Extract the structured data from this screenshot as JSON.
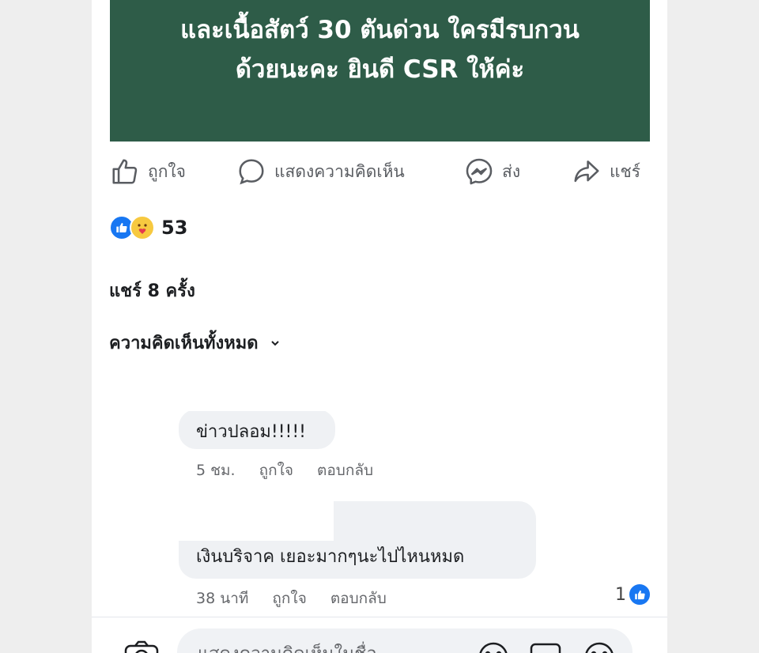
{
  "banner": {
    "line1": "และเนื้อสัตว์ 30 ตันด่วน ใครมีรบกวน",
    "line2": "ด้วยนะคะ ยินดี  CSR ให้ค่ะ"
  },
  "actions": {
    "like": "ถูกใจ",
    "comment": "แสดงความคิดเห็น",
    "send": "ส่ง",
    "share": "แชร์"
  },
  "reactions": {
    "count": "53",
    "icons": [
      "like-reaction-icon",
      "care-reaction-icon"
    ]
  },
  "shares": "แชร์ 8 ครั้ง",
  "comments_filter": {
    "label": "ความคิดเห็นทั้งหมด"
  },
  "comments": [
    {
      "text": "ข่าวปลอม!!!!!",
      "time": "5 ชม.",
      "like": "ถูกใจ",
      "reply": "ตอบกลับ"
    },
    {
      "text": "เงินบริจาค เยอะมากๆนะไปไหนหมด",
      "time": "38 นาที",
      "like": "ถูกใจ",
      "reply": "ตอบกลับ",
      "like_count": "1"
    }
  ],
  "footer": {
    "placeholder": "แสดงความคิดเห็นในชื่อ"
  },
  "colors": {
    "banner": "#2e5c48",
    "brand_blue": "#1877f2",
    "muted_text": "#65676b",
    "bubble": "#eff1f4"
  }
}
